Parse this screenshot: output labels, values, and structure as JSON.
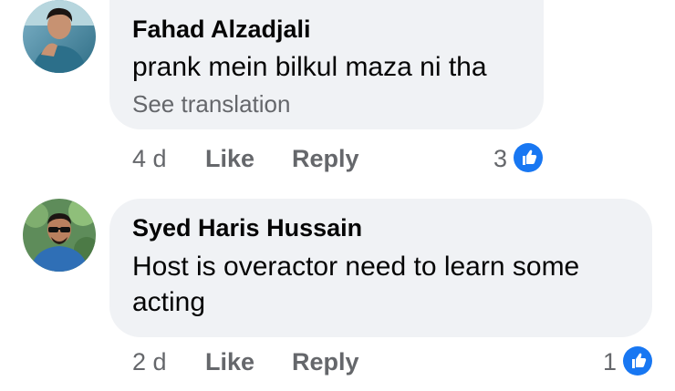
{
  "comments": [
    {
      "author": "Fahad Alzadjali",
      "text": "prank mein bilkul maza ni tha",
      "see_translation": "See translation",
      "time": "4 d",
      "like_label": "Like",
      "reply_label": "Reply",
      "reaction_count": "3",
      "reaction_icon": "thumbs-up-icon"
    },
    {
      "author": "Syed Haris Hussain",
      "text": "Host is overactor need to learn some acting",
      "time": "2 d",
      "like_label": "Like",
      "reply_label": "Reply",
      "reaction_count": "1",
      "reaction_icon": "thumbs-up-icon"
    }
  ],
  "colors": {
    "bubble": "#f0f2f5",
    "secondary_text": "#65676b",
    "like_blue": "#1877f2"
  }
}
